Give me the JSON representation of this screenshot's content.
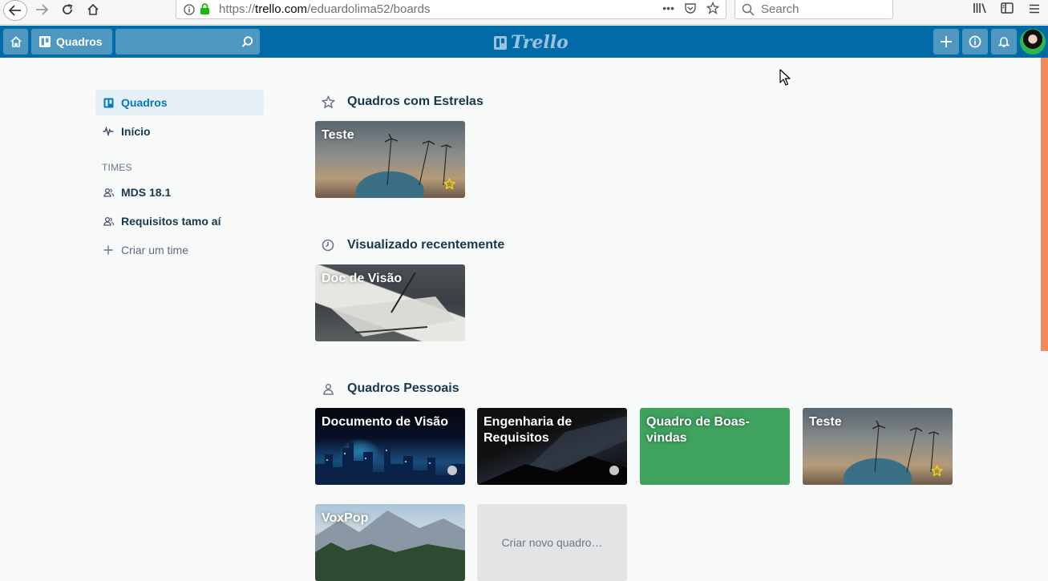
{
  "browser": {
    "url_prefix": "https://",
    "url_host": "trello.com",
    "url_path": "/eduardolima52/boards",
    "search_placeholder": "Search"
  },
  "header": {
    "boards_label": "Quadros",
    "logo_text": "Trello"
  },
  "sidebar": {
    "items": [
      {
        "label": "Quadros",
        "icon": "board-icon",
        "active": true
      },
      {
        "label": "Início",
        "icon": "activity-icon"
      }
    ],
    "teams_heading": "TIMES",
    "teams": [
      {
        "label": "MDS 18.1",
        "icon": "team-icon"
      },
      {
        "label": "Requisitos tamo aí",
        "icon": "team-icon"
      }
    ],
    "create_team": "Criar um time"
  },
  "sections": {
    "starred": {
      "title": "Quadros com Estrelas",
      "boards": [
        {
          "name": "Teste",
          "starred": true
        }
      ]
    },
    "recent": {
      "title": "Visualizado recentemente",
      "boards": [
        {
          "name": "Doc de Visão"
        }
      ]
    },
    "personal": {
      "title": "Quadros Pessoais",
      "boards": [
        {
          "name": "Documento de Visão"
        },
        {
          "name": "Engenharia de Requisitos"
        },
        {
          "name": "Quadro de Boas-vindas"
        },
        {
          "name": "Teste",
          "starred": true
        },
        {
          "name": "VoxPop"
        }
      ],
      "create_label": "Criar novo quadro…"
    }
  },
  "colors": {
    "header": "#026aa7",
    "welcome_board": "#3fa35f",
    "star": "#f2d600"
  }
}
